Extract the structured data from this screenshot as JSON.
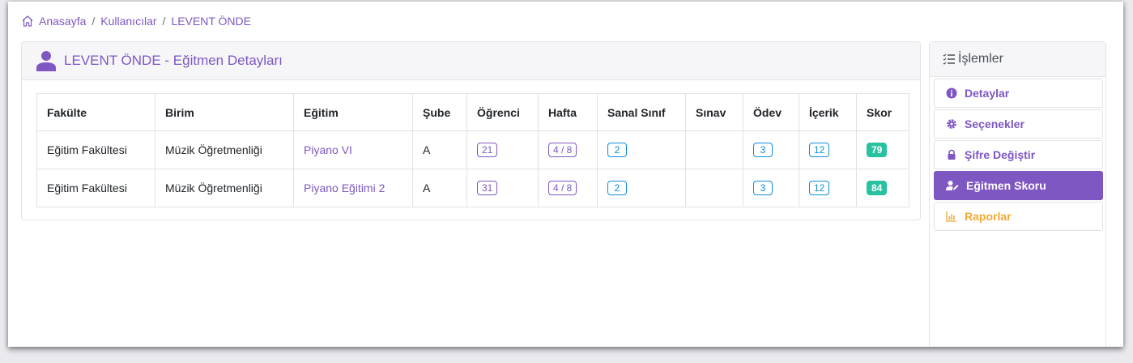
{
  "breadcrumb": {
    "home": "Anasayfa",
    "section": "Kullanıcılar",
    "current": "LEVENT ÖNDE",
    "separator": "/"
  },
  "card": {
    "title": "LEVENT ÖNDE - Eğitmen Detayları"
  },
  "table": {
    "headers": [
      "Fakülte",
      "Birim",
      "Eğitim",
      "Şube",
      "Öğrenci",
      "Hafta",
      "Sanal Sınıf",
      "Sınav",
      "Ödev",
      "İçerik",
      "Skor"
    ],
    "rows": [
      {
        "fakulte": "Eğitim Fakültesi",
        "birim": "Müzik Öğretmenliği",
        "egitim": "Piyano VI",
        "sube": "A",
        "ogrenci": "21",
        "hafta": "4 / 8",
        "sanal": "2",
        "sinav": "",
        "odev": "3",
        "icerik": "12",
        "skor": "79"
      },
      {
        "fakulte": "Eğitim Fakültesi",
        "birim": "Müzik Öğretmenliği",
        "egitim": "Piyano Eğitimi 2",
        "sube": "A",
        "ogrenci": "31",
        "hafta": "4 / 8",
        "sanal": "2",
        "sinav": "",
        "odev": "3",
        "icerik": "12",
        "skor": "84"
      }
    ]
  },
  "panel": {
    "title": "İşlemler",
    "items": [
      {
        "label": "Detaylar",
        "icon": "info-circle-icon"
      },
      {
        "label": "Seçenekler",
        "icon": "cog-icon"
      },
      {
        "label": "Şifre Değiştir",
        "icon": "lock-icon"
      },
      {
        "label": "Eğitmen Skoru",
        "icon": "user-edit-icon",
        "active": true
      },
      {
        "label": "Raporlar",
        "icon": "chart-icon"
      }
    ]
  },
  "colors": {
    "accent": "#7e57c2",
    "info": "#0d8fd8",
    "success": "#28c2a0",
    "warning": "#f4a935"
  }
}
